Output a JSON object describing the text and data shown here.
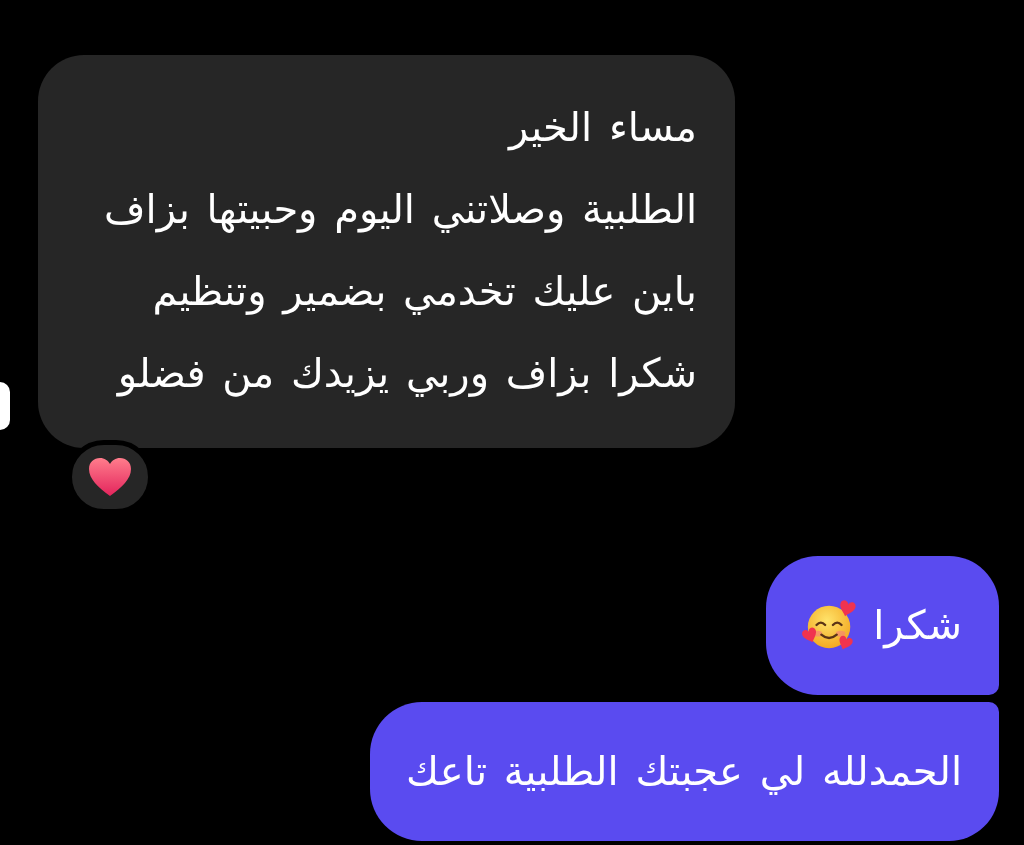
{
  "messages": [
    {
      "kind": "incoming",
      "text": "مساء الخير\nالطلبية وصلاتني اليوم وحبيتها بزاف\nباين عليك تخدمي بضمير وتنظيم\nشكرا بزاف وربي يزيدك من فضلو",
      "reacted": true,
      "emoji": false
    },
    {
      "kind": "outgoing",
      "text": "شكرا",
      "reacted": false,
      "emoji": true
    },
    {
      "kind": "outgoing",
      "text": "الحمدلله لي عجبتك الطلبية تاعك",
      "reacted": false,
      "emoji": false
    }
  ]
}
